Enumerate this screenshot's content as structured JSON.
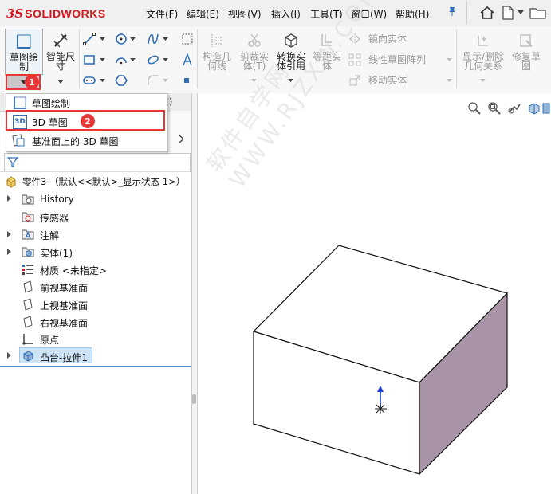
{
  "app": {
    "logo_ds": "3S",
    "logo_text": "SOLIDWORKS"
  },
  "menu": {
    "items": [
      "文件(F)",
      "编辑(E)",
      "视图(V)",
      "插入(I)",
      "工具(T)",
      "窗口(W)",
      "帮助(H)"
    ]
  },
  "toolbar": {
    "sketch_label_1": "草图绘",
    "sketch_label_2": "制",
    "dimension_label_1": "智能尺",
    "dimension_label_2": "寸",
    "construct_1": "构造几",
    "construct_2": "何线",
    "trim_1": "剪裁实",
    "trim_2": "体(T)",
    "convert_1": "转换实",
    "convert_2": "体引用",
    "offset_1": "等距实",
    "offset_2": "体",
    "mirror": "镜向实体",
    "linear_pattern": "线性草图阵列",
    "move": "移动实体",
    "show_relations_1": "显示/删除",
    "show_relations_2": "几何关系",
    "repair_1": "修复草",
    "repair_2": "图"
  },
  "callouts": {
    "one": "1",
    "two": "2"
  },
  "popup": {
    "items": [
      "草图绘制",
      "3D 草图",
      "基准面上的 3D 草图"
    ],
    "icon_3d": "3D"
  },
  "tree": {
    "part": "零件3 （默认<<默认>_显示状态 1>）",
    "items": [
      "History",
      "传感器",
      "注解",
      "实体(1)",
      "材质 <未指定>",
      "前视基准面",
      "上视基准面",
      "右视基准面",
      "原点",
      "凸台-拉伸1"
    ]
  },
  "panel": {
    "tab_hint": "E)"
  },
  "watermark": "软件自学网 WWW.RJZXW.COM",
  "colors": {
    "accent": "#e83535",
    "box_side": "#a995a7",
    "selection": "#cde3f7"
  }
}
